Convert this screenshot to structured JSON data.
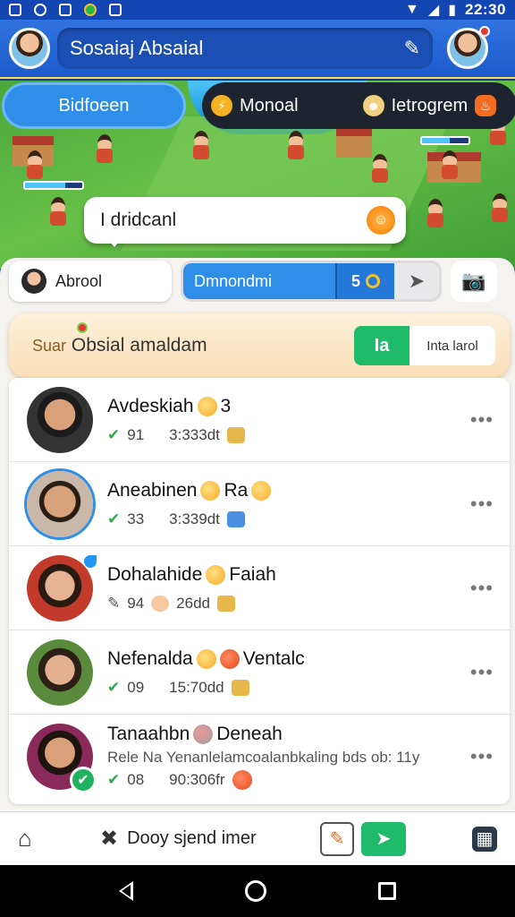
{
  "status_bar": {
    "time": "22:30"
  },
  "header": {
    "title": "Sosaiaj Absaial"
  },
  "scene": {
    "tab_left": "Bidfoeen",
    "tab_right_a": "Monoal",
    "tab_right_b": "Ietrogrem",
    "bubble_text": "I dridcanl"
  },
  "filters": {
    "chip_label": "Abrool",
    "search_value": "Dmnondmi",
    "search_count": "5"
  },
  "banner": {
    "prefix": "Suar",
    "text": "Obsial amaldam",
    "btn_primary": "Ia",
    "btn_secondary": "Inta larol"
  },
  "conversations": [
    {
      "name": "Avdeskiah",
      "suffix": "3",
      "meta_a": "91",
      "meta_b": "3:333dt"
    },
    {
      "name": "Aneabinen",
      "suffix": "Ra",
      "meta_a": "33",
      "meta_b": "3:339dt"
    },
    {
      "name": "Dohalahide",
      "suffix": "Faiah",
      "meta_a": "94",
      "meta_b": "26dd"
    },
    {
      "name": "Nefenalda",
      "suffix": "Ventalc",
      "meta_a": "09",
      "meta_b": "15:70dd"
    },
    {
      "name": "Tanaahbn",
      "suffix": "Deneah",
      "meta_a": "08",
      "meta_b": "90:306fr",
      "preview": "Rele Na Yenanlelamcoalanbkaling bds ob: 11y"
    }
  ],
  "bottom_nav": {
    "compose_label": "Dooy sjend imer"
  }
}
